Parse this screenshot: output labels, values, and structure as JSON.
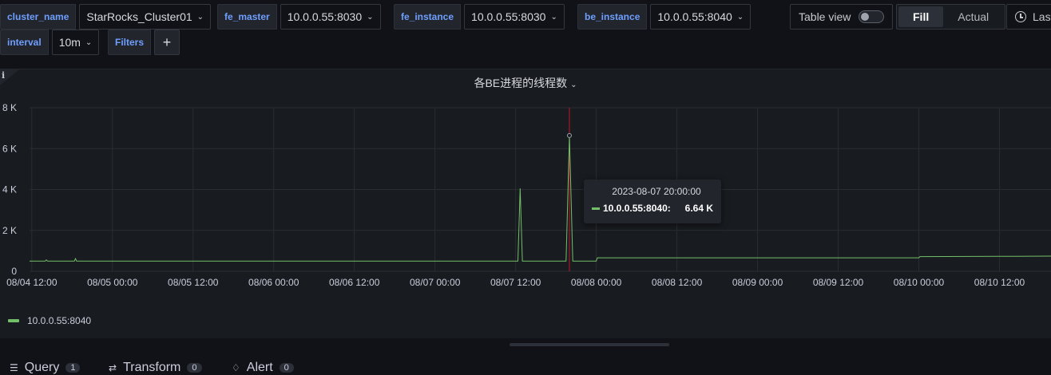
{
  "variables": [
    {
      "label": "cluster_name",
      "value": "StarRocks_Cluster01"
    },
    {
      "label": "fe_master",
      "value": "10.0.0.55:8030"
    },
    {
      "label": "fe_instance",
      "value": "10.0.0.55:8030"
    },
    {
      "label": "be_instance",
      "value": "10.0.0.55:8040"
    },
    {
      "label": "interval",
      "value": "10m"
    }
  ],
  "filters_label": "Filters",
  "add_label": "+",
  "table_view_label": "Table view",
  "view_mode": {
    "fill": "Fill",
    "actual": "Actual",
    "active": "Fill"
  },
  "time_picker_label": "Last",
  "panel": {
    "title": "各BE进程的线程数",
    "info_icon": "i"
  },
  "chart_data": {
    "type": "line",
    "title": "各BE进程的线程数",
    "y_ticks": [
      "0",
      "2 K",
      "4 K",
      "6 K",
      "8 K"
    ],
    "ylim": [
      0,
      8000
    ],
    "x_ticks": [
      "08/04 12:00",
      "08/05 00:00",
      "08/05 12:00",
      "08/06 00:00",
      "08/06 12:00",
      "08/07 00:00",
      "08/07 12:00",
      "08/08 00:00",
      "08/08 12:00",
      "08/09 00:00",
      "08/09 12:00",
      "08/10 00:00",
      "08/10 12:00"
    ],
    "xlim": [
      "2023-08-04 11:40",
      "2023-08-10 19:40"
    ],
    "grid": true,
    "legend_position": "bottom-left",
    "series": [
      {
        "name": "10.0.0.55:8040",
        "color": "#73bf69",
        "x": [
          "2023-08-04 11:40",
          "2023-08-04 14:00",
          "2023-08-04 14:10",
          "2023-08-04 14:20",
          "2023-08-04 18:20",
          "2023-08-04 18:30",
          "2023-08-04 18:40",
          "2023-08-06 12:00",
          "2023-08-07 12:00",
          "2023-08-07 12:20",
          "2023-08-07 12:40",
          "2023-08-07 13:00",
          "2023-08-07 19:30",
          "2023-08-07 20:00",
          "2023-08-07 20:30",
          "2023-08-08 00:00",
          "2023-08-08 00:10",
          "2023-08-09 12:00",
          "2023-08-10 00:00",
          "2023-08-10 00:10",
          "2023-08-10 12:00",
          "2023-08-10 19:40"
        ],
        "y": [
          500,
          500,
          560,
          500,
          500,
          620,
          500,
          500,
          500,
          500,
          4050,
          500,
          500,
          6640,
          500,
          500,
          660,
          660,
          660,
          720,
          730,
          740
        ]
      }
    ]
  },
  "tooltip": {
    "time": "2023-08-07 20:00:00",
    "series": "10.0.0.55:8040:",
    "value": "6.64 K"
  },
  "legend": {
    "label": "10.0.0.55:8040"
  },
  "bottom_tabs": [
    {
      "label": "Query",
      "count": "1"
    },
    {
      "label": "Transform",
      "count": "0"
    },
    {
      "label": "Alert",
      "count": "0"
    }
  ]
}
